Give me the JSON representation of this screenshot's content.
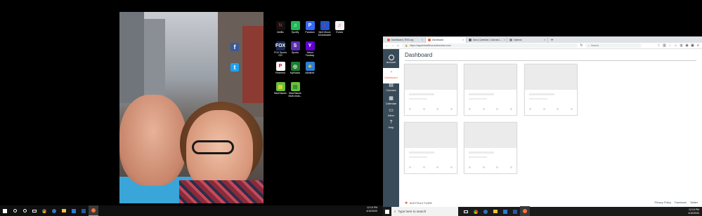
{
  "left_desktop": {
    "icons": [
      {
        "label": "Netflix",
        "icon": "netflix-icon",
        "color": "#111111",
        "glyph": "N",
        "glyph_color": "#e50914"
      },
      {
        "label": "Spotify",
        "icon": "spotify-icon",
        "color": "#1db954",
        "glyph": "♫",
        "glyph_color": "#ffffff"
      },
      {
        "label": "Pandora",
        "icon": "pandora-icon",
        "color": "#3668ff",
        "glyph": "P",
        "glyph_color": "#ffffff"
      },
      {
        "label": "Mp3 Music Downloader",
        "icon": "mp3-downloader-icon",
        "color": "#2255cc",
        "glyph": "♪",
        "glyph_color": "#ff3030"
      },
      {
        "label": "iTunes",
        "icon": "itunes-icon",
        "color": "#f2f2f2",
        "glyph": "♫",
        "glyph_color": "#e04c8a"
      },
      {
        "label": "FOX Sports GO",
        "icon": "fox-sports-icon",
        "color": "#1a2a55",
        "glyph": "FOX",
        "glyph_color": "#ffffff"
      },
      {
        "label": "Sports",
        "icon": "sports-icon",
        "color": "#5a2fb0",
        "glyph": "S",
        "glyph_color": "#ffffff"
      },
      {
        "label": "Yahoo Fantasy",
        "icon": "yahoo-fantasy-icon",
        "color": "#6001d2",
        "glyph": "Y",
        "glyph_color": "#ffffff"
      },
      {
        "label": "Pinterest",
        "icon": "pinterest-icon",
        "color": "#ffffff",
        "glyph": "P",
        "glyph_color": "#e60023"
      },
      {
        "label": "MyRadar",
        "icon": "myradar-icon",
        "color": "#1c7c2f",
        "glyph": "◎",
        "glyph_color": "#ffffff"
      },
      {
        "label": "Weather",
        "icon": "weather-icon",
        "color": "#2a7fd4",
        "glyph": "☀",
        "glyph_color": "#ffcc33"
      },
      {
        "label": "BlueStacks",
        "icon": "bluestacks-icon",
        "color": "#6abf3a",
        "glyph": "▤",
        "glyph_color": "#ffe24a"
      },
      {
        "label": "BlueStacks Multi-Insta...",
        "icon": "bluestacks-multi-icon",
        "color": "#6abf3a",
        "glyph": "▤",
        "glyph_color": "#1c7c2f"
      }
    ],
    "tray": {
      "time": "12:15 PM",
      "date": "4/10/2020"
    }
  },
  "browser": {
    "tabs": [
      {
        "label": "Dashboard | RSS.org",
        "favicon_color": "#e66135"
      },
      {
        "label": "Dashboard",
        "favicon_color": "#e66135",
        "active": true
      },
      {
        "label": "Ask a Question | Canvas L...",
        "favicon_color": "#5a5a5a"
      },
      {
        "label": "Options",
        "favicon_color": "#888888"
      }
    ],
    "url": "https://aspenhealthos.instructure.com",
    "search_placeholder": "Search",
    "accent": "#e66135"
  },
  "canvas": {
    "nav": [
      {
        "label": "Account",
        "icon": "account-icon"
      },
      {
        "label": "Dashboard",
        "icon": "dashboard-icon",
        "active": true
      },
      {
        "label": "Courses",
        "icon": "courses-icon"
      },
      {
        "label": "Calendar",
        "icon": "calendar-icon"
      },
      {
        "label": "Inbox",
        "icon": "inbox-icon"
      },
      {
        "label": "Help",
        "icon": "help-icon"
      }
    ],
    "page_title": "Dashboard",
    "footer_logo": "INSTRUCTURE",
    "footer_links": [
      "Privacy Policy",
      "Facebook",
      "Twitter"
    ],
    "nav_color": "#394b58"
  },
  "right_taskbar": {
    "search_placeholder": "Type here to search",
    "tray": {
      "time": "12:15 PM",
      "date": "4/10/2020"
    }
  }
}
